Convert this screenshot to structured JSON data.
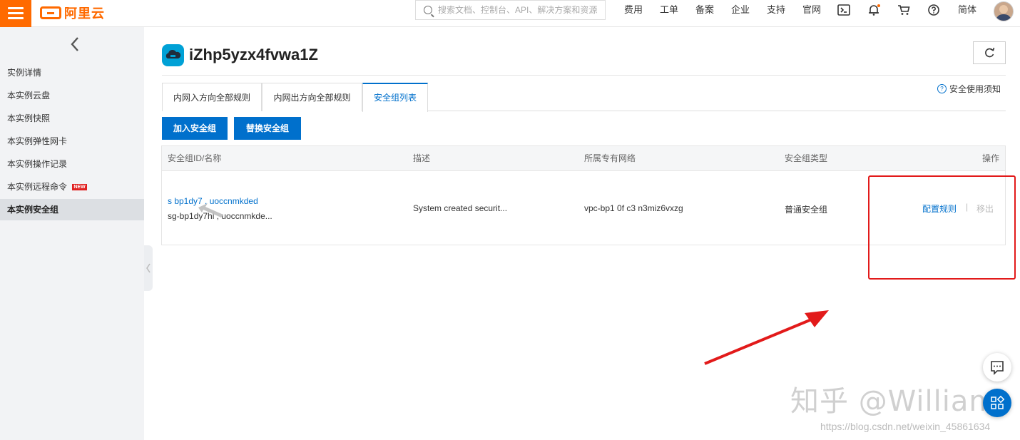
{
  "header": {
    "logo_text": "阿里云",
    "search_placeholder": "搜索文档、控制台、API、解决方案和资源",
    "nav": [
      "费用",
      "工单",
      "备案",
      "企业",
      "支持",
      "官网"
    ],
    "lang": "简体",
    "accent_color": "#ff6a00"
  },
  "sidebar": {
    "items": [
      {
        "label": "实例详情"
      },
      {
        "label": "本实例云盘"
      },
      {
        "label": "本实例快照"
      },
      {
        "label": "本实例弹性网卡"
      },
      {
        "label": "本实例操作记录"
      },
      {
        "label": "本实例远程命令",
        "badge": "NEW"
      },
      {
        "label": "本实例安全组",
        "active": true
      }
    ]
  },
  "main": {
    "title": "iZhp5yzx4fvwa1Z",
    "tabs": [
      {
        "label": "内网入方向全部规则"
      },
      {
        "label": "内网出方向全部规则"
      },
      {
        "label": "安全组列表",
        "active": true
      }
    ],
    "help_link": "安全使用须知",
    "buttons": {
      "join": "加入安全组",
      "replace": "替换安全组"
    },
    "table": {
      "columns": [
        "安全组ID/名称",
        "描述",
        "所属专有网络",
        "安全组类型",
        "操作"
      ],
      "rows": [
        {
          "id_link": "s    bp1dy7    ,  uoccnmkded",
          "name": "sg-bp1dy7hi  ,  uoccnmkde...",
          "description": "System created securit...",
          "vpc": "vpc-bp1      0f  c3    n3miz6vxzg",
          "type": "普通安全组",
          "actions": {
            "configure": "配置规则",
            "separator": "|",
            "remove": "移出"
          }
        }
      ]
    },
    "primary_color": "#0070cc"
  },
  "overlay": {
    "watermark": "知乎 @William",
    "url": "https://blog.csdn.net/weixin_45861634",
    "highlight_color": "#e21a1a"
  }
}
